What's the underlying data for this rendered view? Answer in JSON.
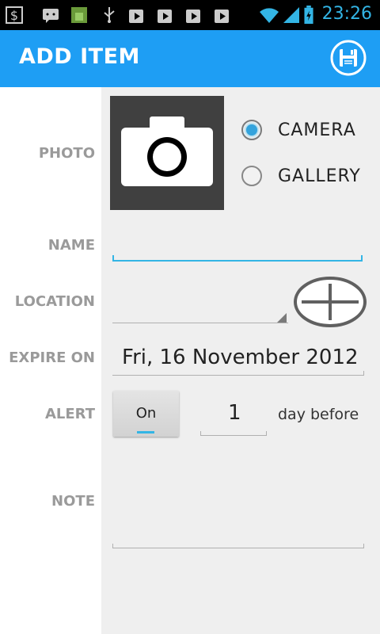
{
  "status_bar": {
    "time": "23:26",
    "battery_color": "#33b5e5"
  },
  "action_bar": {
    "title": "ADD ITEM",
    "save_icon": "save-icon",
    "color": "#1e9ef4"
  },
  "labels": {
    "photo": "PHOTO",
    "name": "NAME",
    "location": "LOCATION",
    "expire_on": "EXPIRE ON",
    "alert": "ALERT",
    "note": "NOTE"
  },
  "photo": {
    "options": [
      {
        "label": "CAMERA",
        "checked": true
      },
      {
        "label": "GALLERY",
        "checked": false
      }
    ]
  },
  "name": {
    "value": ""
  },
  "location": {
    "value": ""
  },
  "expire": {
    "date": "Fri, 16 November 2012"
  },
  "alert": {
    "toggle": "On",
    "days": "1",
    "suffix": "day before"
  },
  "note": {
    "value": ""
  },
  "colors": {
    "accent": "#33b5e5",
    "form_bg": "#efefef"
  }
}
